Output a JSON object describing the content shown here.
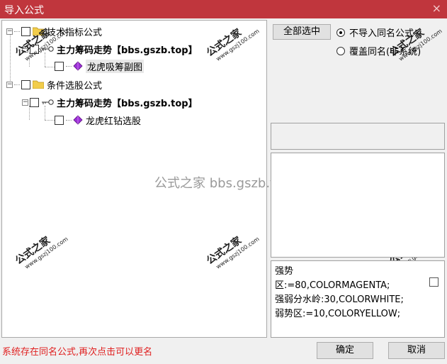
{
  "window": {
    "title": "导入公式",
    "close_glyph": "×"
  },
  "tree": {
    "group1": {
      "label": "技术指标公式"
    },
    "group1_item": {
      "label": "主力筹码走势【bbs.gszb.top】"
    },
    "group1_sub": {
      "label": "龙虎吸筹副图"
    },
    "group2": {
      "label": "条件选股公式"
    },
    "group2_item": {
      "label": "主力筹码走势【bbs.gszb.top】"
    },
    "group2_sub": {
      "label": "龙虎红钻选股"
    },
    "expander_glyph": "−"
  },
  "watermark": {
    "center": "公式之家 bbs.gszb.top",
    "stamp_big": "公式之家",
    "stamp_small": "www.gszj100.com"
  },
  "options": {
    "select_all": "全部选中",
    "radio_skip": "不导入同名公式",
    "radio_overwrite": "覆盖同名(非系统)",
    "selected": "skip"
  },
  "preview": {
    "lines": [
      "强势",
      "区:=80,COLORMAGENTA;",
      "强弱分水岭:30,COLORWHITE;",
      "弱势区:=10,COLORYELLOW;"
    ]
  },
  "status": {
    "message": "系统存在同名公式,再次点击可以更名"
  },
  "buttons": {
    "ok": "确定",
    "cancel": "取消"
  },
  "icons": {
    "folder": "folder-icon",
    "formula_item": "key-icon",
    "formula_sub": "gem-icon"
  },
  "colors": {
    "titlebar": "#c0363d",
    "status_text": "#e02020",
    "gem": "#9b2fd6",
    "folder": "#f2cd4b"
  }
}
